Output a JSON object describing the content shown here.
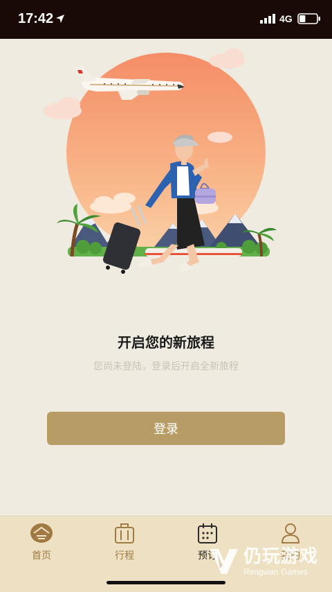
{
  "status_bar": {
    "time": "17:42",
    "network": "4G",
    "battery_level": 0.35
  },
  "illustration": {
    "sun_color": "#f79e71",
    "accent_color": "#b89c65"
  },
  "main": {
    "headline": "开启您的新旅程",
    "subtext": "您尚未登陆，登录后开启全新旅程",
    "login_button": "登录"
  },
  "tab_bar": {
    "tabs": [
      {
        "label": "首页",
        "icon": "home-icon"
      },
      {
        "label": "行程",
        "icon": "suitcase-icon"
      },
      {
        "label": "预订",
        "icon": "calendar-icon",
        "active": true
      },
      {
        "label": "我的",
        "icon": "user-icon"
      }
    ]
  },
  "watermark": {
    "title": "仍玩游戏",
    "subtitle": "Rengwan Games"
  }
}
